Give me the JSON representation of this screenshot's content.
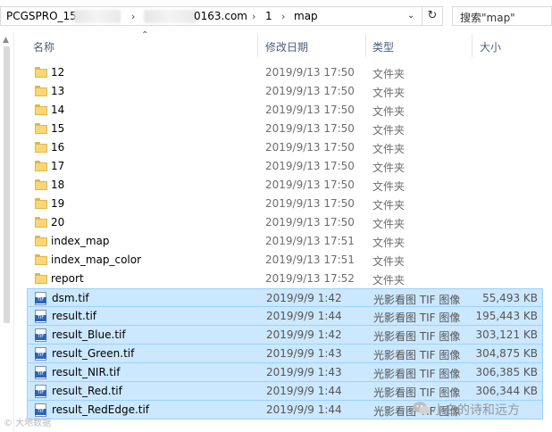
{
  "address_bar": {
    "crumbs": [
      "PCGSPRO_15",
      "0163.com",
      "1",
      "map"
    ],
    "separator": "›"
  },
  "search": {
    "placeholder": "搜索\"map\""
  },
  "columns": {
    "name": "名称",
    "date": "修改日期",
    "type": "类型",
    "size": "大小"
  },
  "files": [
    {
      "name": "12",
      "date": "2019/9/13 17:50",
      "type": "文件夹",
      "size": "",
      "icon": "folder-icon",
      "selected": false
    },
    {
      "name": "13",
      "date": "2019/9/13 17:50",
      "type": "文件夹",
      "size": "",
      "icon": "folder-icon",
      "selected": false
    },
    {
      "name": "14",
      "date": "2019/9/13 17:50",
      "type": "文件夹",
      "size": "",
      "icon": "folder-icon",
      "selected": false
    },
    {
      "name": "15",
      "date": "2019/9/13 17:50",
      "type": "文件夹",
      "size": "",
      "icon": "folder-icon",
      "selected": false
    },
    {
      "name": "16",
      "date": "2019/9/13 17:50",
      "type": "文件夹",
      "size": "",
      "icon": "folder-icon",
      "selected": false
    },
    {
      "name": "17",
      "date": "2019/9/13 17:50",
      "type": "文件夹",
      "size": "",
      "icon": "folder-icon",
      "selected": false
    },
    {
      "name": "18",
      "date": "2019/9/13 17:50",
      "type": "文件夹",
      "size": "",
      "icon": "folder-icon",
      "selected": false
    },
    {
      "name": "19",
      "date": "2019/9/13 17:50",
      "type": "文件夹",
      "size": "",
      "icon": "folder-icon",
      "selected": false
    },
    {
      "name": "20",
      "date": "2019/9/13 17:50",
      "type": "文件夹",
      "size": "",
      "icon": "folder-icon",
      "selected": false
    },
    {
      "name": "index_map",
      "date": "2019/9/13 17:51",
      "type": "文件夹",
      "size": "",
      "icon": "folder-icon",
      "selected": false
    },
    {
      "name": "index_map_color",
      "date": "2019/9/13 17:51",
      "type": "文件夹",
      "size": "",
      "icon": "folder-icon",
      "selected": false
    },
    {
      "name": "report",
      "date": "2019/9/13 17:52",
      "type": "文件夹",
      "size": "",
      "icon": "folder-icon",
      "selected": false
    },
    {
      "name": "dsm.tif",
      "date": "2019/9/9 1:42",
      "type": "光影看图 TIF 图像",
      "size": "55,493 KB",
      "icon": "tif-image-icon",
      "selected": true
    },
    {
      "name": "result.tif",
      "date": "2019/9/9 1:44",
      "type": "光影看图 TIF 图像",
      "size": "195,443 KB",
      "icon": "tif-image-icon",
      "selected": true
    },
    {
      "name": "result_Blue.tif",
      "date": "2019/9/9 1:42",
      "type": "光影看图 TIF 图像",
      "size": "303,121 KB",
      "icon": "tif-image-icon",
      "selected": true
    },
    {
      "name": "result_Green.tif",
      "date": "2019/9/9 1:43",
      "type": "光影看图 TIF 图像",
      "size": "304,875 KB",
      "icon": "tif-image-icon",
      "selected": true
    },
    {
      "name": "result_NIR.tif",
      "date": "2019/9/9 1:43",
      "type": "光影看图 TIF 图像",
      "size": "306,385 KB",
      "icon": "tif-image-icon",
      "selected": true
    },
    {
      "name": "result_Red.tif",
      "date": "2019/9/9 1:44",
      "type": "光影看图 TIF 图像",
      "size": "306,344 KB",
      "icon": "tif-image-icon",
      "selected": true
    },
    {
      "name": "result_RedEdge.tif",
      "date": "2019/9/9 1:44",
      "type": "光影看图 TIF 图像",
      "size": "",
      "icon": "tif-image-icon",
      "selected": true
    }
  ],
  "watermarks": {
    "left": "© 大地数据",
    "right": "小白的诗和远方"
  },
  "colors": {
    "selection_fill": "#cce8ff",
    "selection_border": "#99d1ff",
    "header_text": "#4c607a",
    "folder": "#f8d775"
  }
}
